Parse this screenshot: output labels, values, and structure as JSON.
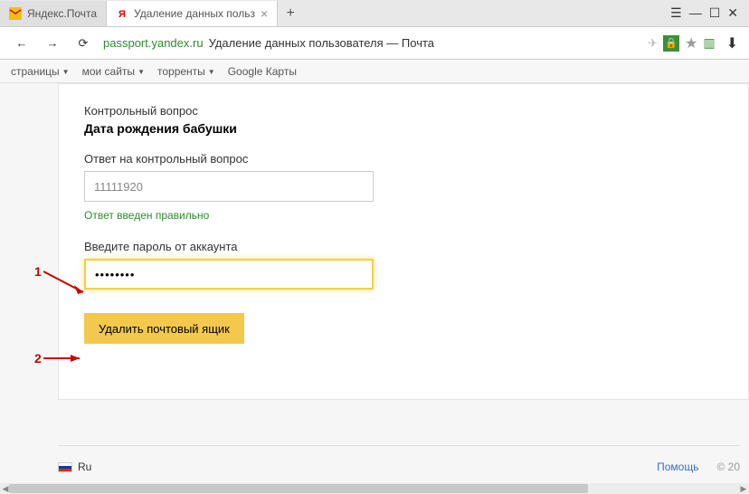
{
  "tabs": {
    "tab1": "Яндекс.Почта",
    "tab2": "Удаление данных польз"
  },
  "address": {
    "domain": "passport.yandex.ru",
    "title": "Удаление данных пользователя — Почта"
  },
  "bookmarks": {
    "pages": "страницы",
    "mysites": "мои сайты",
    "torrents": "торренты",
    "gmaps": "Google Карты"
  },
  "form": {
    "question_label": "Контрольный вопрос",
    "question_text": "Дата рождения бабушки",
    "answer_label": "Ответ на контрольный вопрос",
    "answer_value": "11111920",
    "answer_success": "Ответ введен правильно",
    "password_label": "Введите пароль от аккаунта",
    "password_value": "••••••••",
    "submit_label": "Удалить почтовый ящик"
  },
  "annotations": {
    "one": "1",
    "two": "2"
  },
  "footer": {
    "lang": "Ru",
    "help": "Помощь",
    "copy": "© 20"
  }
}
